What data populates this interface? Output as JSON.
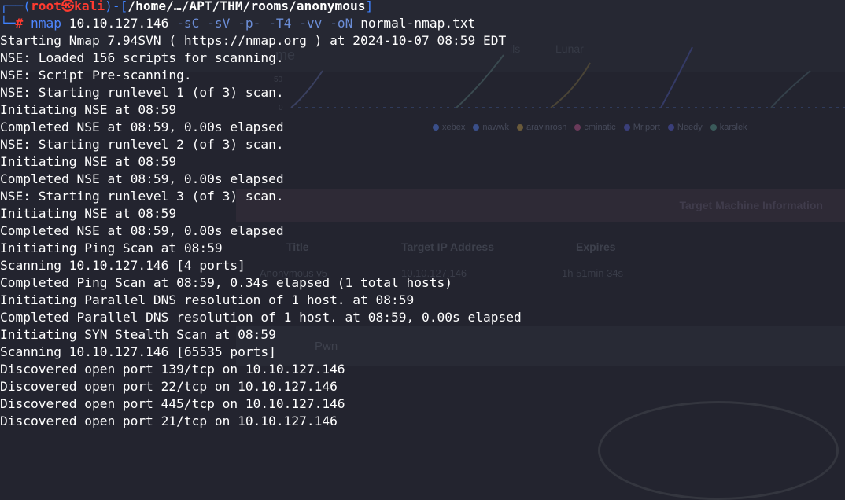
{
  "prompt": {
    "corner_top": "┌──(",
    "user_host_user": "root",
    "skull": "㉿",
    "host": "kali",
    "close_paren": ")-[",
    "cwd": "/home/…/APT/THM/rooms/anonymous",
    "close_bracket": "]",
    "corner_bottom": "└─",
    "hash": "#",
    "command": "nmap",
    "target": "10.10.127.146",
    "flags": [
      "-sC",
      "-sV",
      "-p-",
      "-T4",
      "-vv",
      "-oN"
    ],
    "outfile": "normal-nmap.txt"
  },
  "output_lines": [
    "Starting Nmap 7.94SVN ( https://nmap.org ) at 2024-10-07 08:59 EDT",
    "NSE: Loaded 156 scripts for scanning.",
    "NSE: Script Pre-scanning.",
    "NSE: Starting runlevel 1 (of 3) scan.",
    "Initiating NSE at 08:59",
    "Completed NSE at 08:59, 0.00s elapsed",
    "NSE: Starting runlevel 2 (of 3) scan.",
    "Initiating NSE at 08:59",
    "Completed NSE at 08:59, 0.00s elapsed",
    "NSE: Starting runlevel 3 (of 3) scan.",
    "Initiating NSE at 08:59",
    "Completed NSE at 08:59, 0.00s elapsed",
    "Initiating Ping Scan at 08:59",
    "Scanning 10.10.127.146 [4 ports]",
    "Completed Ping Scan at 08:59, 0.34s elapsed (1 total hosts)",
    "Initiating Parallel DNS resolution of 1 host. at 08:59",
    "Completed Parallel DNS resolution of 1 host. at 08:59, 0.00s elapsed",
    "Initiating SYN Stealth Scan at 08:59",
    "Scanning 10.10.127.146 [65535 ports]",
    "Discovered open port 139/tcp on 10.10.127.146",
    "Discovered open port 22/tcp on 10.10.127.146",
    "Discovered open port 445/tcp on 10.10.127.146",
    "Discovered open port 21/tcp on 10.10.127.146"
  ],
  "background_page": {
    "header_items": [
      "ils",
      "Lunar"
    ],
    "chart_title_fragment": "me",
    "chart_tick_labels": [
      "50",
      "0"
    ],
    "legend": [
      {
        "name": "xebex",
        "color": "#3a4f8a"
      },
      {
        "name": "nawwk",
        "color": "#3a4f8a"
      },
      {
        "name": "aravinrosh",
        "color": "#6a5a3a"
      },
      {
        "name": "cminatic",
        "color": "#6a3a5a"
      },
      {
        "name": "Mr.port",
        "color": "#3a3f7a"
      },
      {
        "name": "Needy",
        "color": "#3a3f7a"
      },
      {
        "name": "karslek",
        "color": "#3a5a5a"
      }
    ],
    "section_title": "Target Machine Information",
    "columns": [
      "Title",
      "Target IP Address",
      "Expires"
    ],
    "values": [
      "Anonymous v5",
      "10.10.127.146",
      "1h 51min 34s"
    ],
    "tab_label": "Pwn"
  },
  "colors": {
    "background": "#23242f",
    "prompt_frame": "#3f82ff",
    "prompt_user": "#ff3b30",
    "command": "#4f86ff",
    "flags": "#6b8dd6",
    "text": "#ffffff"
  }
}
